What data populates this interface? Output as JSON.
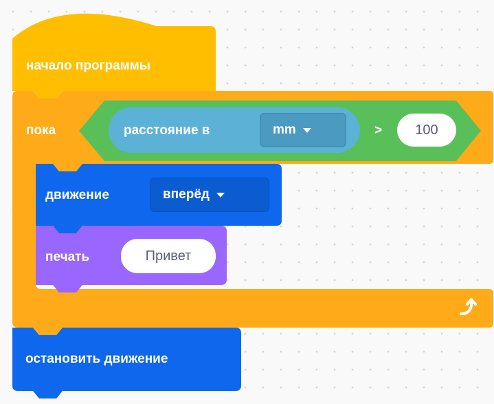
{
  "colors": {
    "events": "#ffbf00",
    "control": "#ffab19",
    "operators": "#59c059",
    "sensing": "#5cb1d6",
    "motion": "#0e67ed",
    "looks": "#9966ff",
    "canvas": "#f9f9f9"
  },
  "blocks": {
    "start": {
      "label": "начало программы"
    },
    "while": {
      "label": "пока",
      "sensor_label": "расстояние в",
      "unit_value": "mm",
      "operator": ">",
      "threshold": "100",
      "loop_icon": "loop-arrow-icon"
    },
    "move": {
      "label": "движение",
      "direction_value": "вперёд"
    },
    "print": {
      "label": "печать",
      "text_value": "Привет"
    },
    "stop": {
      "label": "остановить движение"
    }
  }
}
